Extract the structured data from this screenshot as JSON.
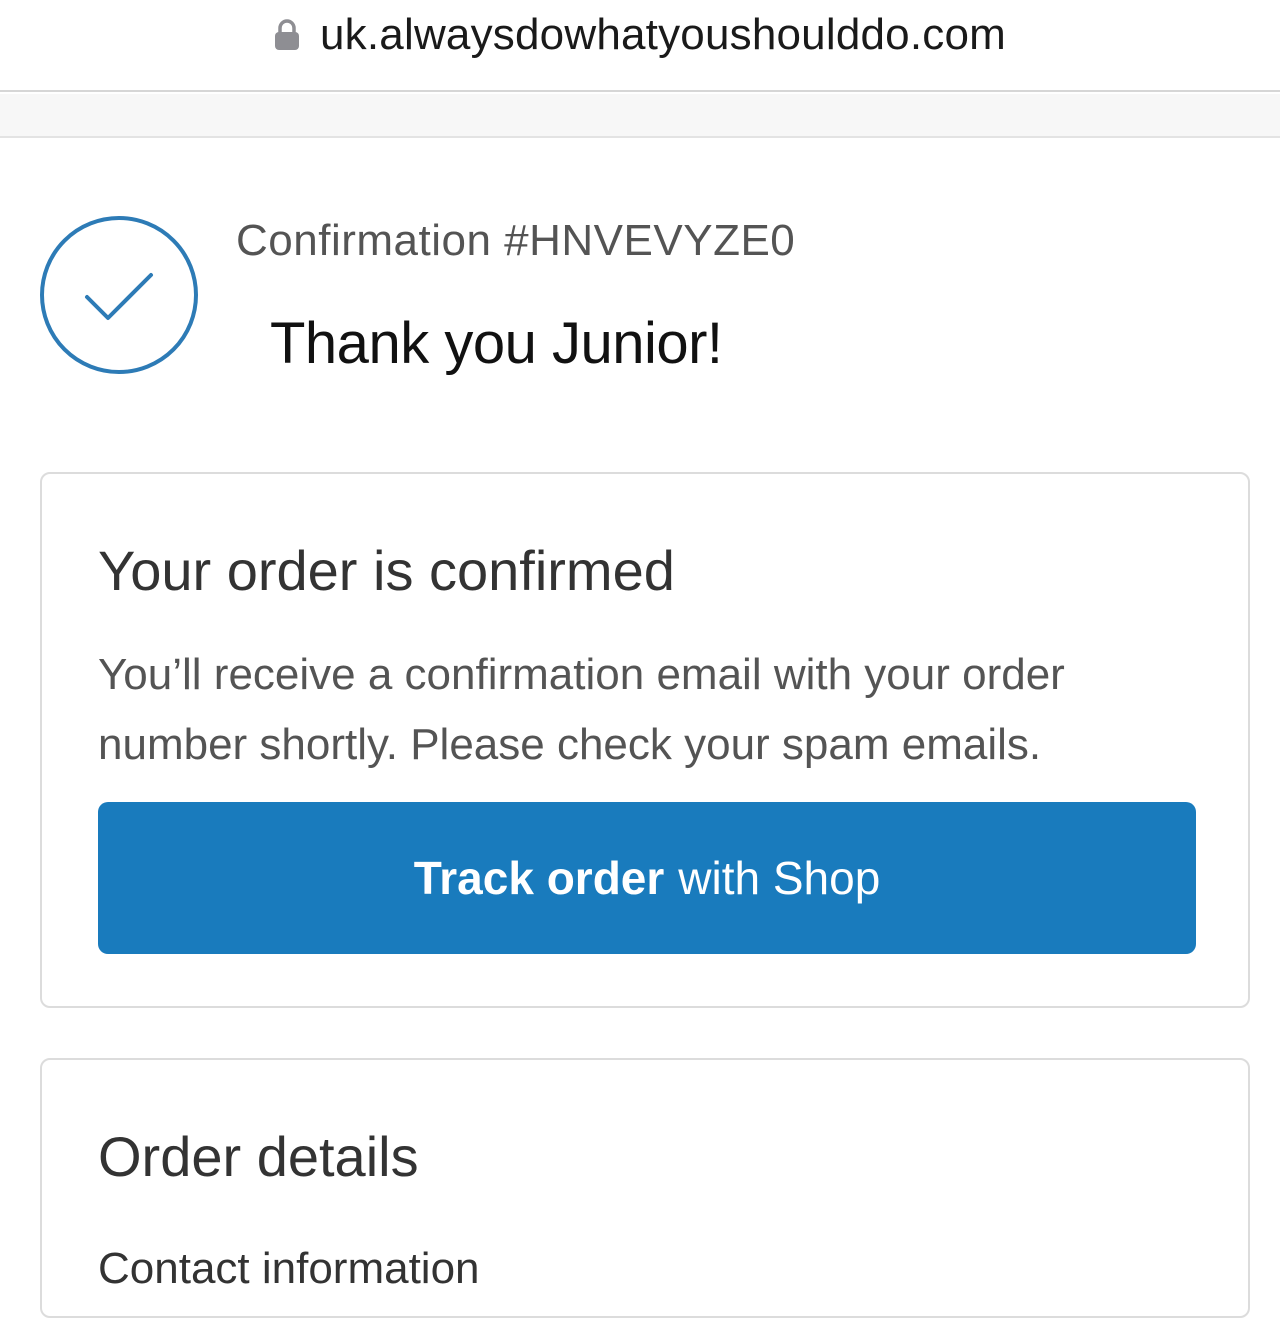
{
  "browser": {
    "url": "uk.alwaysdowhatyoushoulddo.com",
    "lock_icon": "lock-icon"
  },
  "header": {
    "confirmation": "Confirmation #HNVEVYZE0",
    "greeting": "Thank you Junior!",
    "status_icon": "check-circle-icon"
  },
  "confirmed_card": {
    "title": "Your order is confirmed",
    "message_line1": "You’ll receive a confirmation email with your order",
    "message_line2": "number shortly. Please check your spam emails.",
    "button_bold": "Track order",
    "button_rest": "with Shop"
  },
  "details_card": {
    "title": "Order details",
    "contact_label": "Contact information"
  },
  "colors": {
    "accent": "#197bbd",
    "check_stroke": "#2d7bb6"
  }
}
